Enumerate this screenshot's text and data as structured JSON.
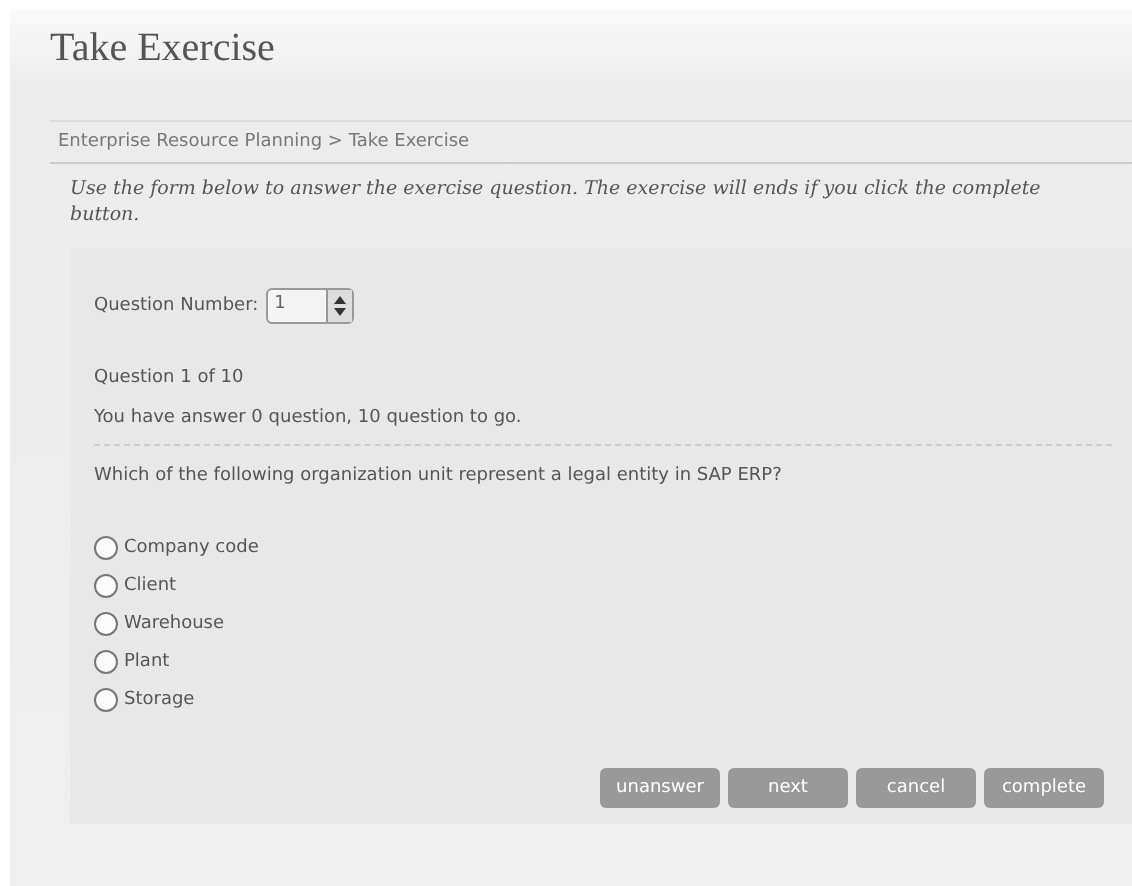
{
  "title": "Take Exercise",
  "breadcrumb": "Enterprise Resource Planning > Take Exercise",
  "instructions": "Use the form below to answer the exercise question. The exercise will ends if you click the complete button.",
  "question_number": {
    "label": "Question Number:",
    "value": "1"
  },
  "progress": "Question 1 of 10",
  "status": "You have answer 0 question, 10 question to go.",
  "question": "Which of the following organization unit represent a legal entity in SAP ERP?",
  "options": [
    {
      "label": "Company code",
      "selected": false
    },
    {
      "label": "Client",
      "selected": false
    },
    {
      "label": "Warehouse",
      "selected": false
    },
    {
      "label": "Plant",
      "selected": false
    },
    {
      "label": "Storage",
      "selected": false
    }
  ],
  "buttons": [
    "unanswer",
    "next",
    "cancel",
    "complete"
  ]
}
